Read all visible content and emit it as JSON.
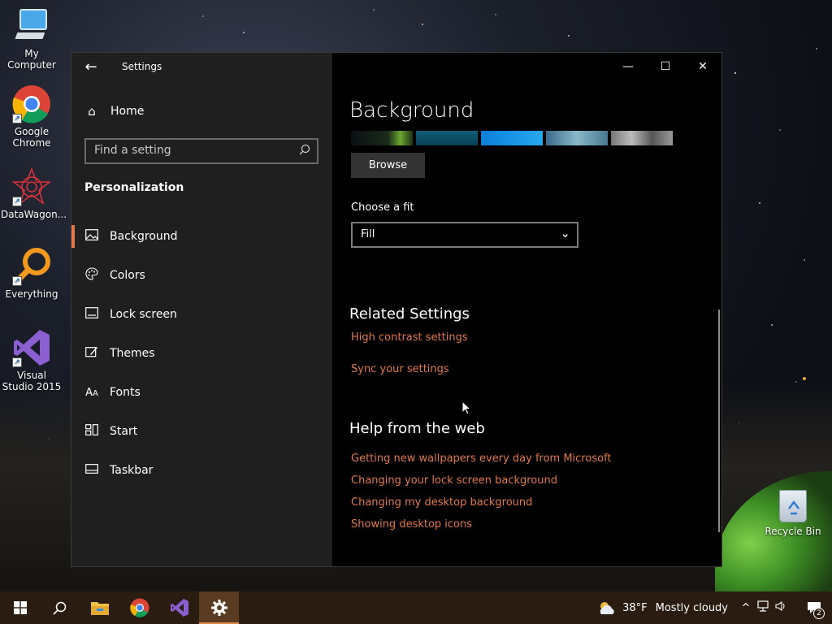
{
  "desktop": {
    "icons": [
      {
        "label": "My Computer",
        "icon": "computer-icon"
      },
      {
        "label": "Google Chrome",
        "icon": "chrome-icon"
      },
      {
        "label": "DataWagon...",
        "icon": "datawagon-icon"
      },
      {
        "label": "Everything",
        "icon": "everything-search-icon"
      },
      {
        "label": "Visual Studio 2015",
        "icon": "visual-studio-icon"
      }
    ],
    "recycle_bin": {
      "label": "Recycle Bin",
      "icon": "recycle-bin-icon"
    }
  },
  "window": {
    "title": "Settings",
    "controls": {
      "minimize": "—",
      "maximize": "☐",
      "close": "✕"
    }
  },
  "nav": {
    "home_label": "Home",
    "search_placeholder": "Find a setting",
    "section": "Personalization",
    "items": [
      {
        "label": "Background",
        "icon": "picture-icon",
        "active": true
      },
      {
        "label": "Colors",
        "icon": "palette-icon"
      },
      {
        "label": "Lock screen",
        "icon": "lock-screen-icon"
      },
      {
        "label": "Themes",
        "icon": "themes-icon"
      },
      {
        "label": "Fonts",
        "icon": "fonts-icon"
      },
      {
        "label": "Start",
        "icon": "start-icon"
      },
      {
        "label": "Taskbar",
        "icon": "taskbar-icon"
      }
    ]
  },
  "content": {
    "title": "Background",
    "browse_label": "Browse",
    "fit_label": "Choose a fit",
    "fit_value": "Fill",
    "related_heading": "Related Settings",
    "related_links": [
      "High contrast settings",
      "Sync your settings"
    ],
    "help_heading": "Help from the web",
    "help_links": [
      "Getting new wallpapers every day from Microsoft",
      "Changing your lock screen background",
      "Changing my desktop background",
      "Showing desktop icons"
    ]
  },
  "taskbar": {
    "apps": [
      "start-icon",
      "search-icon",
      "file-explorer-icon",
      "chrome-icon",
      "visual-studio-icon",
      "settings-icon"
    ],
    "weather_temp": "38°F",
    "weather_text": "Mostly cloudy",
    "notification_count": "2"
  },
  "colors": {
    "accent": "#e0784a",
    "nav_bg": "#1f1f1f",
    "content_bg": "#000000",
    "taskbar_bg": "#2a1c10"
  }
}
